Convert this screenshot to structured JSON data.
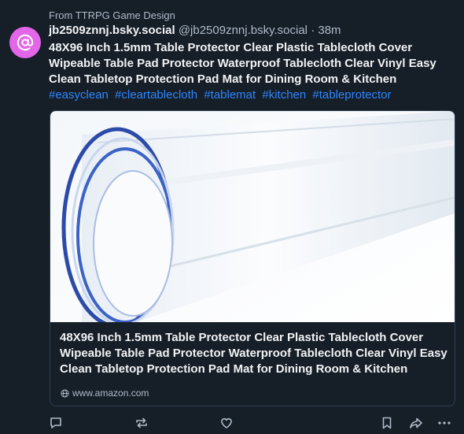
{
  "post": {
    "source": "From TTRPG Game Design",
    "display_name": "jb2509znnj.bsky.social",
    "handle": "@jb2509znnj.bsky.social",
    "separator": "·",
    "time": "38m",
    "text": "48X96 Inch 1.5mm Table Protector Clear Plastic Tablecloth Cover Wipeable Table Pad Protector Waterproof Tablecloth Clear Vinyl Easy Clean Tabletop Protection Pad Mat for Dining Room & Kitchen",
    "hashtags": [
      "#easyclean",
      "#cleartablecloth",
      "#tablemat",
      "#kitchen",
      "#tableprotector"
    ]
  },
  "link_card": {
    "title": "48X96 Inch 1.5mm Table Protector Clear Plastic Tablecloth Cover Wipeable Table Pad Protector Waterproof Tablecloth Clear Vinyl Easy Clean Tabletop Protection Pad Mat for Dining Room & Kitchen",
    "domain": "www.amazon.com",
    "image_alt": "clear-vinyl-roll-image"
  },
  "actions": {
    "reply_icon": "reply-icon",
    "repost_icon": "repost-icon",
    "like_icon": "heart-icon",
    "bookmark_icon": "bookmark-icon",
    "share_icon": "share-icon",
    "more_icon": "more-icon"
  },
  "colors": {
    "background": "#161e27",
    "avatar": "#e366e8",
    "hashtag": "#2d86ff",
    "muted": "#aebbc9"
  }
}
